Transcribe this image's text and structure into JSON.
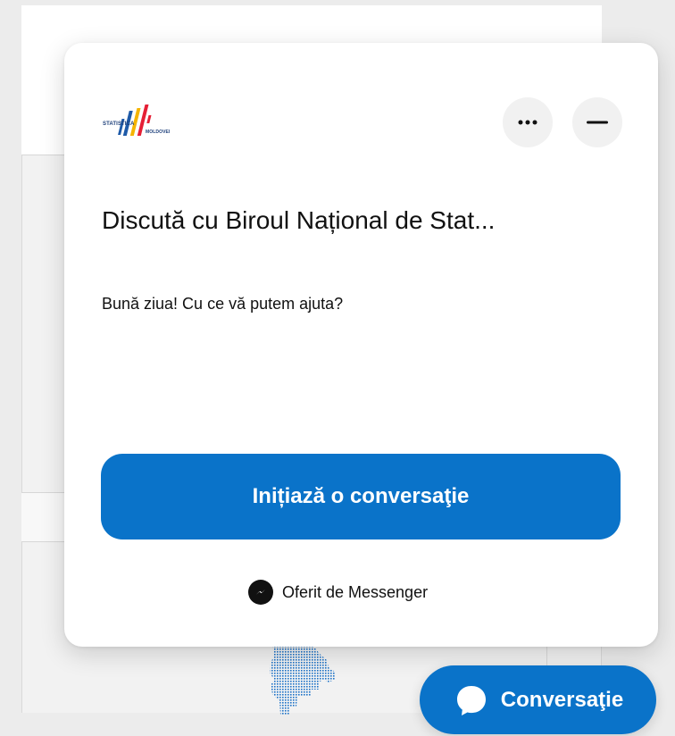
{
  "app": {
    "brand": {
      "name_top": "STATISTICA",
      "name_bottom": "MOLDOVEI",
      "logo_icon": "statistica-moldovei-logo-icon"
    }
  },
  "chat_widget": {
    "title": "Discută cu Biroul Național de Stat...",
    "greeting": "Bună ziua! Cu ce vă putem ajuta?",
    "cta_label": "Inițiază o conversaţie",
    "powered_by": "Oferit de Messenger",
    "actions": [
      {
        "name": "more-options",
        "icon": "ellipsis-icon"
      },
      {
        "name": "minimize",
        "icon": "minus-icon"
      }
    ]
  },
  "floating_button": {
    "label": "Conversaţie",
    "icon": "messenger-chat-icon"
  },
  "colors": {
    "primary": "#0a73c9",
    "card_background": "#ffffff",
    "text_primary": "#111111",
    "button_background": "#f1f1f1"
  }
}
